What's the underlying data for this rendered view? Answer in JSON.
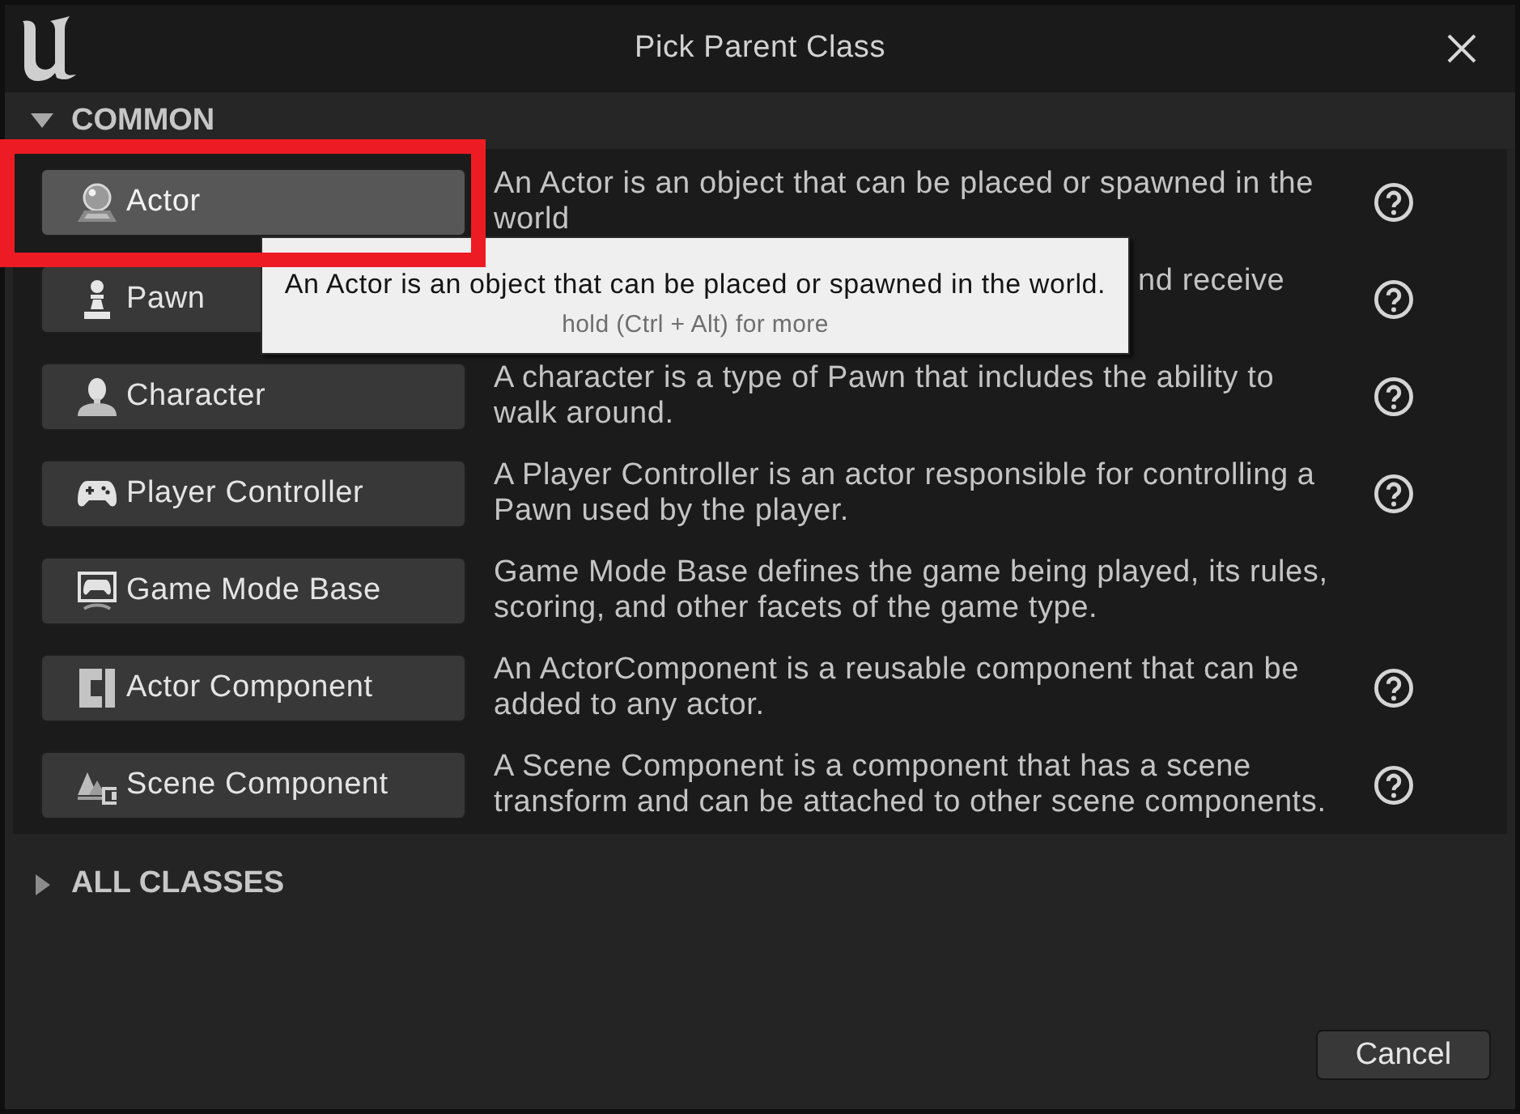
{
  "window": {
    "title": "Pick Parent Class"
  },
  "sections": [
    {
      "title": "COMMON",
      "expanded": true,
      "rows": [
        {
          "kind": "actor",
          "label": "Actor",
          "description": "An Actor is an object that can be placed or spawned in the world",
          "help": true,
          "hovered": true,
          "highlighted": true,
          "covered": false
        },
        {
          "kind": "pawn",
          "label": "Pawn",
          "description": "nd receive",
          "help": true,
          "hovered": false,
          "highlighted": false,
          "covered": true
        },
        {
          "kind": "character",
          "label": "Character",
          "description": "A character is a type of Pawn that includes the ability to walk around.",
          "help": true,
          "hovered": false,
          "highlighted": false,
          "covered": false
        },
        {
          "kind": "controller",
          "label": "Player Controller",
          "description": "A Player Controller is an actor responsible for controlling a Pawn used by the player.",
          "help": true,
          "hovered": false,
          "highlighted": false,
          "covered": false
        },
        {
          "kind": "gamemode",
          "label": "Game Mode Base",
          "description": "Game Mode Base defines the game being played, its rules, scoring, and other facets of the game type.",
          "help": false,
          "hovered": false,
          "highlighted": false,
          "covered": false
        },
        {
          "kind": "component",
          "label": "Actor Component",
          "description": "An ActorComponent is a reusable component that can be added to any actor.",
          "help": true,
          "hovered": false,
          "highlighted": false,
          "covered": false
        },
        {
          "kind": "scene",
          "label": "Scene Component",
          "description": "A Scene Component is a component that has a scene transform and can be attached to other scene components.",
          "help": true,
          "hovered": false,
          "highlighted": false,
          "covered": false
        }
      ]
    },
    {
      "title": "ALL CLASSES",
      "expanded": false
    }
  ],
  "tooltip": {
    "text": "An Actor is an object that can be placed or spawned in the world.",
    "hint": "hold (Ctrl + Alt) for more"
  },
  "buttons": [
    "Cancel"
  ]
}
